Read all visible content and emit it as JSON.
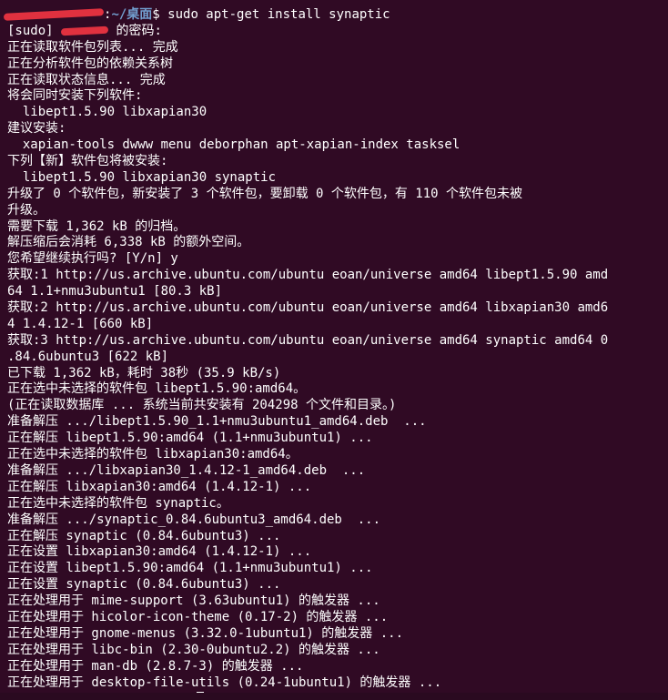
{
  "app": {
    "colors": {
      "background": "#300a24",
      "foreground": "#ffffff",
      "path": "#729fcf",
      "redaction": "#e0313f"
    }
  },
  "prompt": {
    "separator": ":",
    "path": "~/桌面",
    "symbol": "$ ",
    "command": "sudo apt-get install synaptic"
  },
  "sudo": {
    "prefix": "[sudo] ",
    "suffix": " 的密码:"
  },
  "output": [
    "正在读取软件包列表... 完成",
    "正在分析软件包的依赖关系树",
    "正在读取状态信息... 完成",
    "将会同时安装下列软件:",
    "  libept1.5.90 libxapian30",
    "建议安装:",
    "  xapian-tools dwww menu deborphan apt-xapian-index tasksel",
    "下列【新】软件包将被安装:",
    "  libept1.5.90 libxapian30 synaptic",
    "升级了 0 个软件包，新安装了 3 个软件包，要卸载 0 个软件包，有 110 个软件包未被",
    "升级。",
    "需要下载 1,362 kB 的归档。",
    "解压缩后会消耗 6,338 kB 的额外空间。",
    "您希望继续执行吗? [Y/n] y",
    "获取:1 http://us.archive.ubuntu.com/ubuntu eoan/universe amd64 libept1.5.90 amd",
    "64 1.1+nmu3ubuntu1 [80.3 kB]",
    "获取:2 http://us.archive.ubuntu.com/ubuntu eoan/universe amd64 libxapian30 amd6",
    "4 1.4.12-1 [660 kB]",
    "获取:3 http://us.archive.ubuntu.com/ubuntu eoan/universe amd64 synaptic amd64 0",
    ".84.6ubuntu3 [622 kB]",
    "已下载 1,362 kB，耗时 38秒 (35.9 kB/s)",
    "正在选中未选择的软件包 libept1.5.90:amd64。",
    "(正在读取数据库 ... 系统当前共安装有 204298 个文件和目录。)",
    "准备解压 .../libept1.5.90_1.1+nmu3ubuntu1_amd64.deb  ...",
    "正在解压 libept1.5.90:amd64 (1.1+nmu3ubuntu1) ...",
    "正在选中未选择的软件包 libxapian30:amd64。",
    "准备解压 .../libxapian30_1.4.12-1_amd64.deb  ...",
    "正在解压 libxapian30:amd64 (1.4.12-1) ...",
    "正在选中未选择的软件包 synaptic。",
    "准备解压 .../synaptic_0.84.6ubuntu3_amd64.deb  ...",
    "正在解压 synaptic (0.84.6ubuntu3) ...",
    "正在设置 libxapian30:amd64 (1.4.12-1) ...",
    "正在设置 libept1.5.90:amd64 (1.1+nmu3ubuntu1) ...",
    "正在设置 synaptic (0.84.6ubuntu3) ...",
    "正在处理用于 mime-support (3.63ubuntu1) 的触发器 ...",
    "正在处理用于 hicolor-icon-theme (0.17-2) 的触发器 ...",
    "正在处理用于 gnome-menus (3.32.0-1ubuntu1) 的触发器 ...",
    "正在处理用于 libc-bin (2.30-0ubuntu2.2) 的触发器 ...",
    "正在处理用于 man-db (2.8.7-3) 的触发器 ...",
    "正在处理用于 desktop-file-utils (0.24-1ubuntu1) 的触发器 ..."
  ]
}
